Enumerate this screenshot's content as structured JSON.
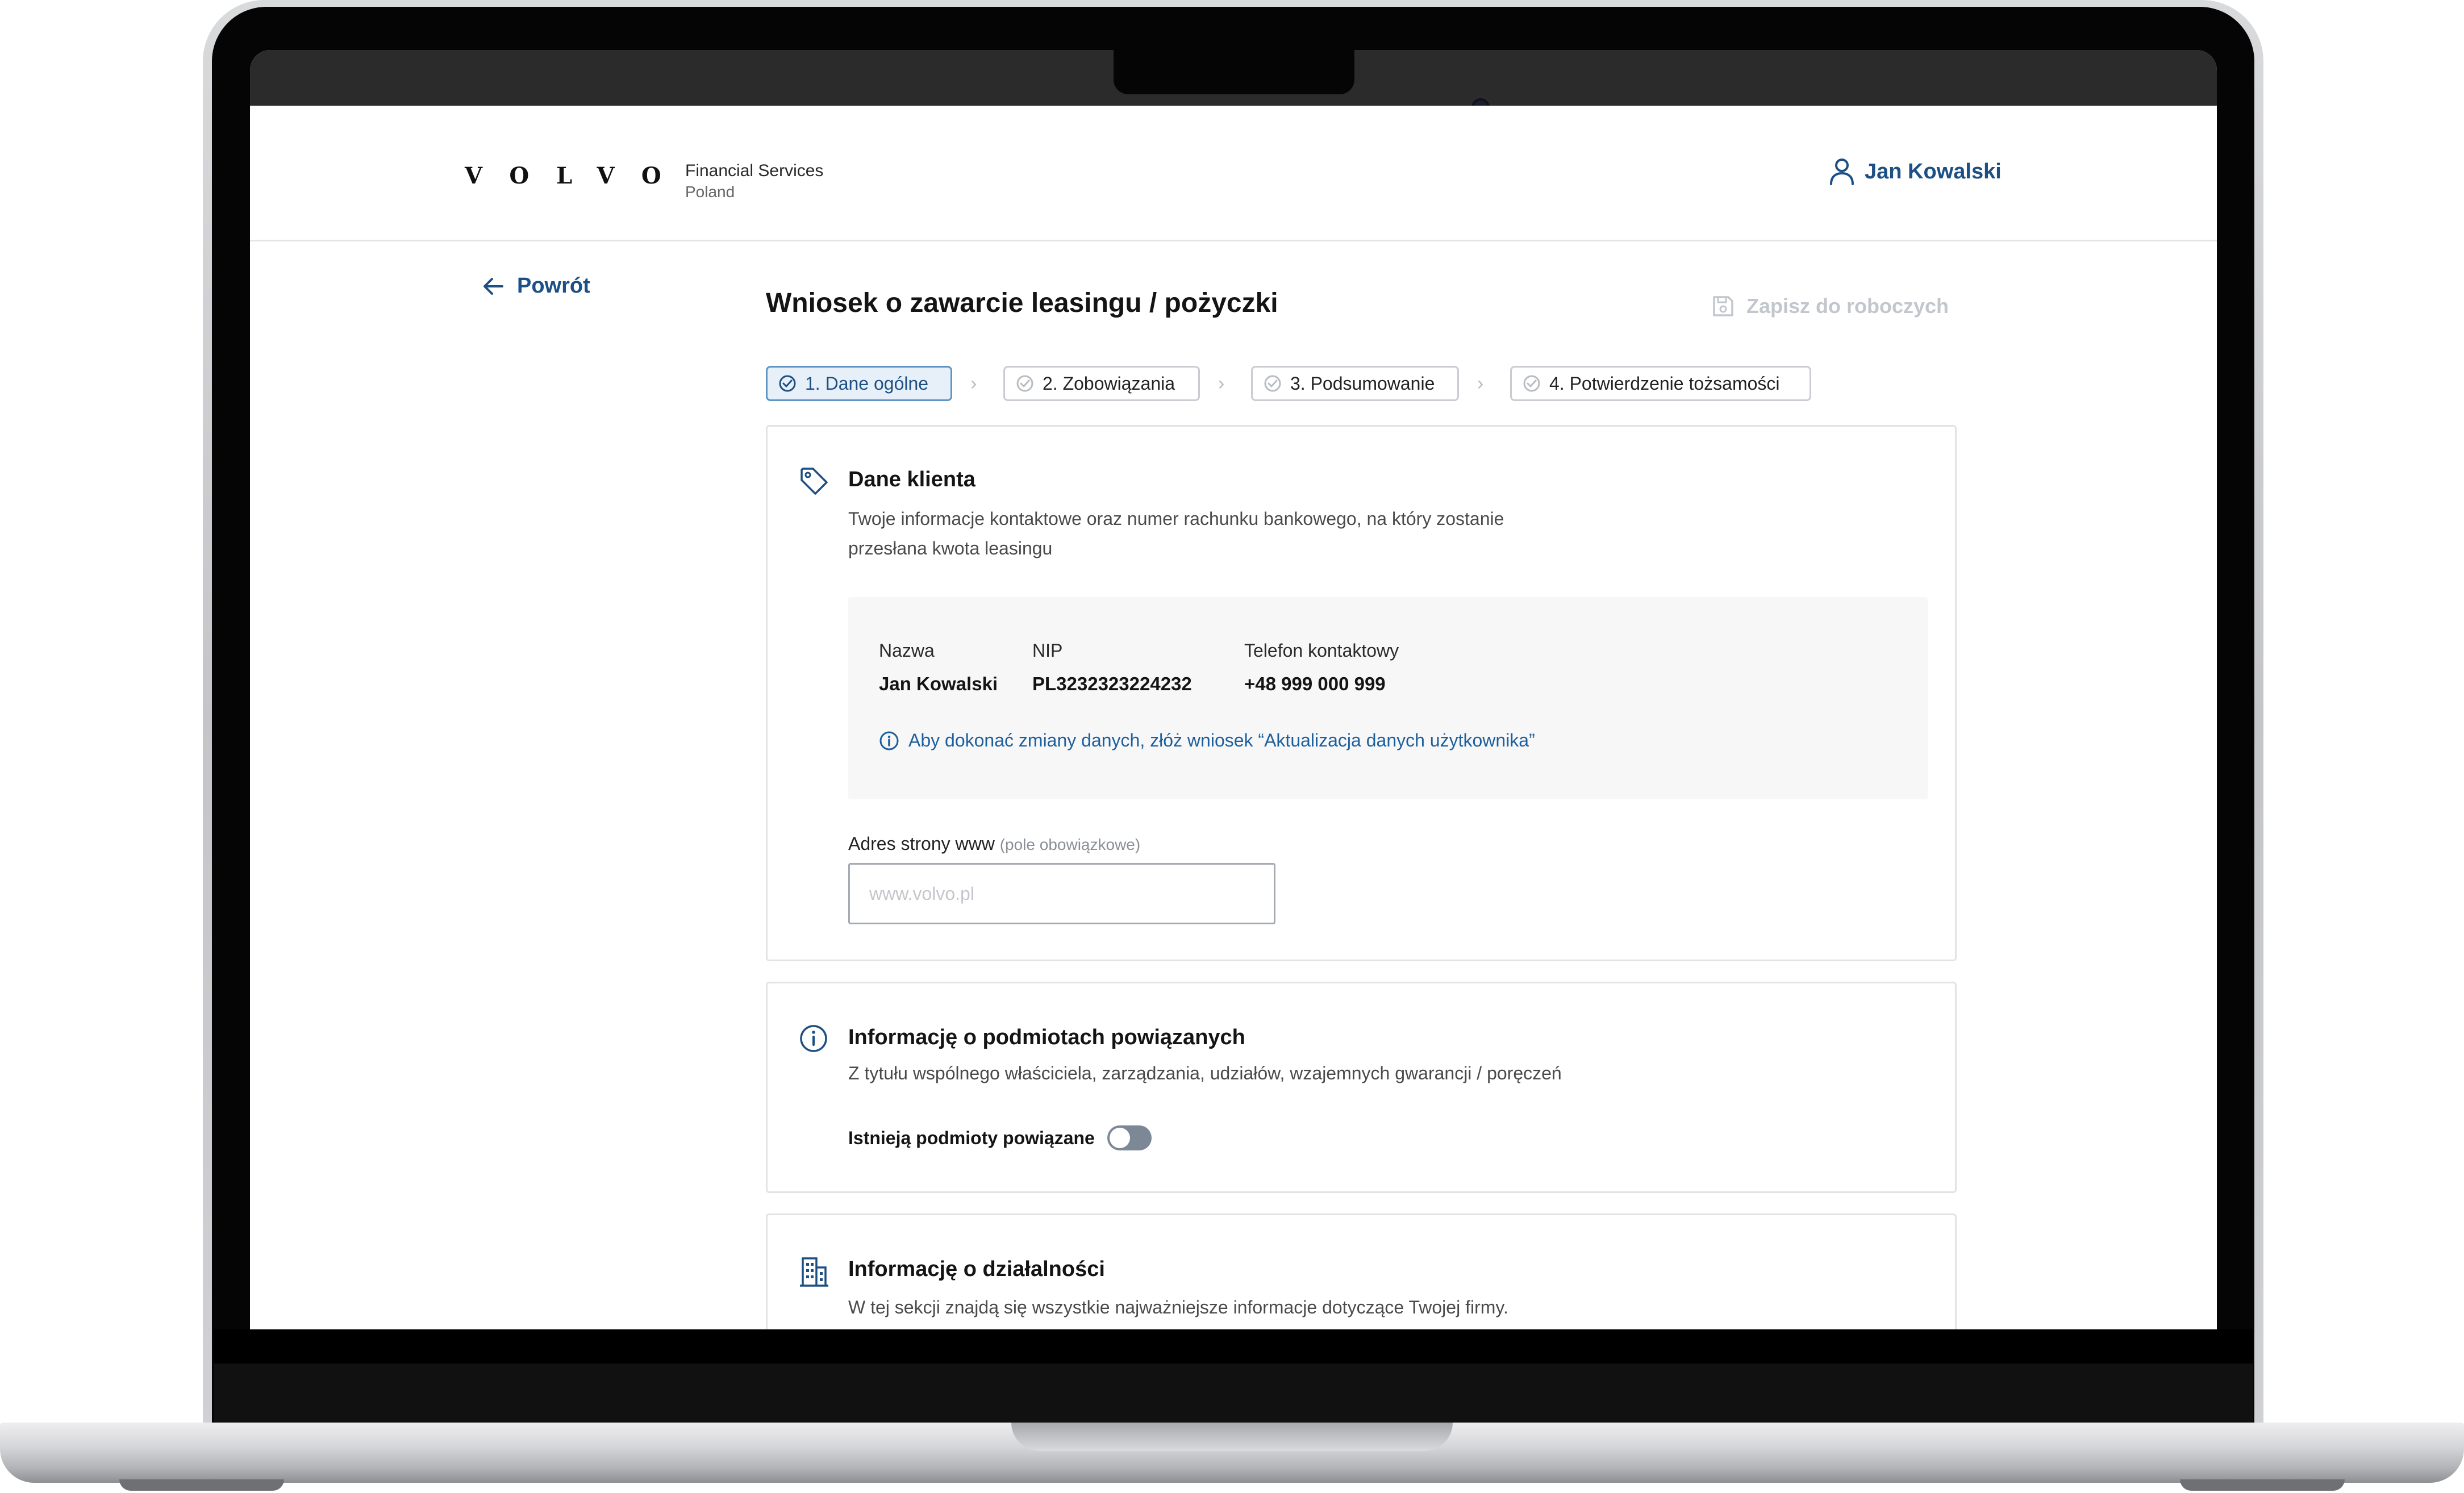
{
  "header": {
    "logo": "VOLVO",
    "brand_line1": "Financial Services",
    "brand_line2": "Poland",
    "user_name": "Jan Kowalski"
  },
  "nav": {
    "back_label": "Powrót"
  },
  "page": {
    "title": "Wniosek o zawarcie leasingu / pożyczki",
    "save_draft_label": "Zapisz do roboczych"
  },
  "steps": [
    {
      "label": "1. Dane ogólne",
      "state": "active"
    },
    {
      "label": "2. Zobowiązania",
      "state": "pending"
    },
    {
      "label": "3. Podsumowanie",
      "state": "pending"
    },
    {
      "label": "4. Potwierdzenie tożsamości",
      "state": "pending"
    }
  ],
  "client_section": {
    "title": "Dane klienta",
    "description": "Twoje informacje kontaktowe oraz numer rachunku bankowego, na który zostanie przesłana kwota leasingu",
    "fields": [
      {
        "label": "Nazwa",
        "value": "Jan Kowalski"
      },
      {
        "label": "NIP",
        "value": "PL3232323224232"
      },
      {
        "label": "Telefon kontaktowy",
        "value": "+48 999 000 999"
      }
    ],
    "notice": "Aby dokonać zmiany danych, złóż wniosek “Aktualizacja danych użytkownika”",
    "website": {
      "label": "Adres strony www",
      "optional": "(pole obowiązkowe)",
      "placeholder": "www.volvo.pl",
      "value": ""
    }
  },
  "related_section": {
    "title": "Informację o podmiotach powiązanych",
    "description": "Z tytułu wspólnego właściciela, zarządzania, udziałów, wzajemnych gwarancji / poręczeń",
    "toggle_label": "Istnieją podmioty powiązane",
    "toggle_on": false
  },
  "business_section": {
    "title": "Informację o działalności",
    "description": "W tej sekcji znajdą się wszystkie najważniejsze informacje dotyczące Twojej firmy."
  },
  "colors": {
    "accent": "#1c4f84",
    "link": "#1c5f9c",
    "active_step_bg": "#e7f0f8",
    "toggle_off": "#7d8896",
    "disabled": "#c2c7cd"
  },
  "icons": {
    "user": "user-icon",
    "back": "arrow-left-icon",
    "save": "floppy-disk-icon",
    "step_check": "check-circle-icon",
    "client": "tag-icon",
    "related": "info-circle-icon",
    "business": "building-icon"
  }
}
